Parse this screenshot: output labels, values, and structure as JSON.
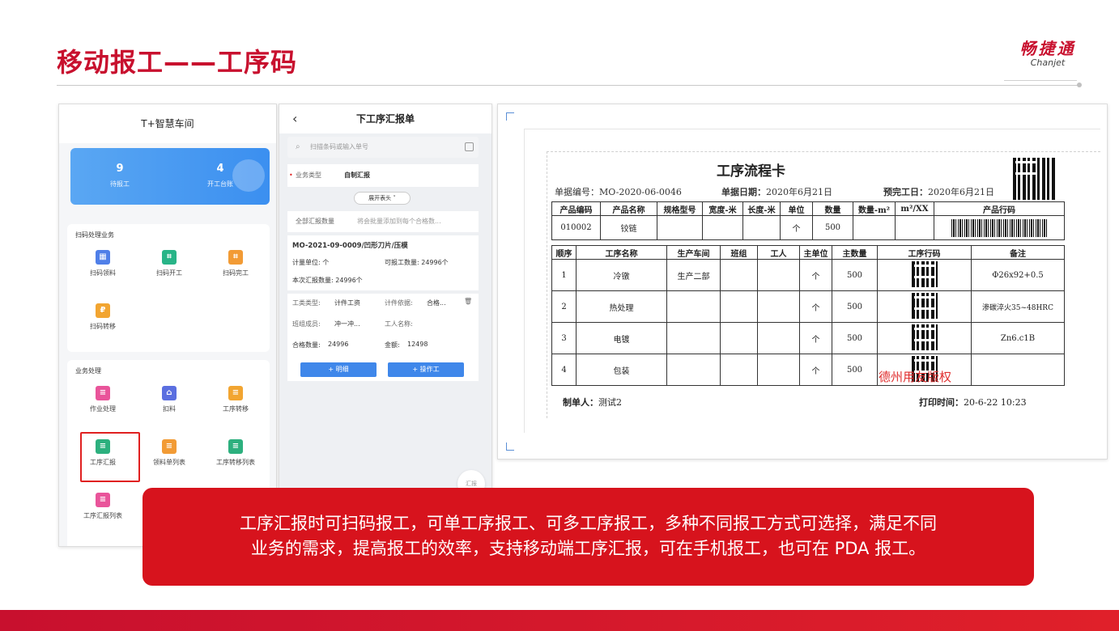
{
  "slide": {
    "title": "移动报工——工序码",
    "logo_cn": "畅捷通",
    "logo_en": "Chanjet"
  },
  "phone1": {
    "app_title": "T+智慧车间",
    "stats": [
      {
        "value": "9",
        "label": "待报工"
      },
      {
        "value": "4",
        "label": "开工台账"
      }
    ],
    "scan_section_title": "扫码处理业务",
    "scan_tiles": [
      {
        "label": "扫码领料",
        "icon": "scan-material-icon",
        "color": "#4f7fe8"
      },
      {
        "label": "扫码开工",
        "icon": "scan-start-icon",
        "color": "#28b487"
      },
      {
        "label": "扫码完工",
        "icon": "scan-finish-icon",
        "color": "#f29b35"
      },
      {
        "label": "扫码转移",
        "icon": "scan-transfer-icon",
        "color": "#f2a531"
      }
    ],
    "biz_section_title": "业务处理",
    "biz_tiles": [
      {
        "label": "作业处理",
        "icon": "job-icon",
        "color": "#e9549a"
      },
      {
        "label": "扣料",
        "icon": "deduct-icon",
        "color": "#5b6fe0"
      },
      {
        "label": "工序转移",
        "icon": "process-transfer-icon",
        "color": "#f2a531"
      },
      {
        "label": "工序汇报",
        "icon": "process-report-icon",
        "color": "#2db07e"
      },
      {
        "label": "领料单列表",
        "icon": "requisition-list-icon",
        "color": "#f29b35"
      },
      {
        "label": "工序转移列表",
        "icon": "transfer-list-icon",
        "color": "#2db07e"
      },
      {
        "label": "工序汇报列表",
        "icon": "report-list-icon",
        "color": "#e9549a"
      }
    ]
  },
  "phone2": {
    "back": "‹",
    "title": "下工序汇报单",
    "search_placeholder": "扫描条码或输入单号",
    "biz_type_label": "业务类型",
    "biz_type_value": "自制汇报",
    "expand_tag": "展开表头 ˅",
    "qty_label": "全部汇报数量",
    "qty_hint": "将会批量添加到每个合格数...",
    "order_no": "MO-2021-09-0009/凹形刀片/压模",
    "unit_label": "计量单位: 个",
    "reportable_label": "可报工数量: 24996个",
    "current_label": "本次汇报数量: 24996个",
    "worktype_label": "工类类型:",
    "worktype_value": "计件工资",
    "piece_label": "计件依据:",
    "piece_value": "合格...",
    "team_label": "班组成员:",
    "team_value": "冲一冲...",
    "worker_label": "工人名称:",
    "qualified_label": "合格数量:",
    "qualified_value": "24996",
    "amount_label": "金额:",
    "amount_value": "12498",
    "btn_detail": "+ 明细",
    "btn_operator": "+ 操作工",
    "float_btn": "汇报"
  },
  "flowcard": {
    "title": "工序流程卡",
    "doc_no_label": "单据编号：",
    "doc_no": "MO-2020-06-0046",
    "doc_date_label": "单据日期：",
    "doc_date": "2020年6月21日",
    "due_label": "预完工日：",
    "due_date": "2020年6月21日",
    "product_headers": [
      "产品编码",
      "产品名称",
      "规格型号",
      "宽度-米",
      "长度-米",
      "单位",
      "数量",
      "数量-m²",
      "m²/XX",
      "产品行码"
    ],
    "product_row": [
      "010002",
      "铰链",
      "",
      "",
      "",
      "个",
      "500",
      "",
      ""
    ],
    "process_headers": [
      "顺序",
      "工序名称",
      "生产车间",
      "班组",
      "工人",
      "主单位",
      "主数量",
      "工序行码",
      "备注"
    ],
    "process_rows": [
      [
        "1",
        "冷镦",
        "生产二部",
        "",
        "",
        "个",
        "500",
        "Φ26x92+0.5"
      ],
      [
        "2",
        "热处理",
        "",
        "",
        "",
        "个",
        "500",
        "渗碳淬火35~48HRC"
      ],
      [
        "3",
        "电镀",
        "",
        "",
        "",
        "个",
        "500",
        "Zn6.c1B"
      ],
      [
        "4",
        "包装",
        "",
        "",
        "",
        "个",
        "500",
        ""
      ]
    ],
    "maker_label": "制单人：",
    "maker": "测试2",
    "print_label": "打印时间：",
    "print_time": "20-6-22 10:23",
    "watermark": "德州用友版权"
  },
  "callout": {
    "line1": "工序汇报时可扫码报工，可单工序报工、可多工序报工，多种不同报工方式可选择，满足不同",
    "line2": "业务的需求，提高报工的效率，支持移动端工序汇报，可在手机报工，也可在 PDA 报工。"
  },
  "colors": {
    "brand_red": "#c8102e",
    "callout_red": "#d7131d",
    "accent_blue": "#3f87ea"
  }
}
